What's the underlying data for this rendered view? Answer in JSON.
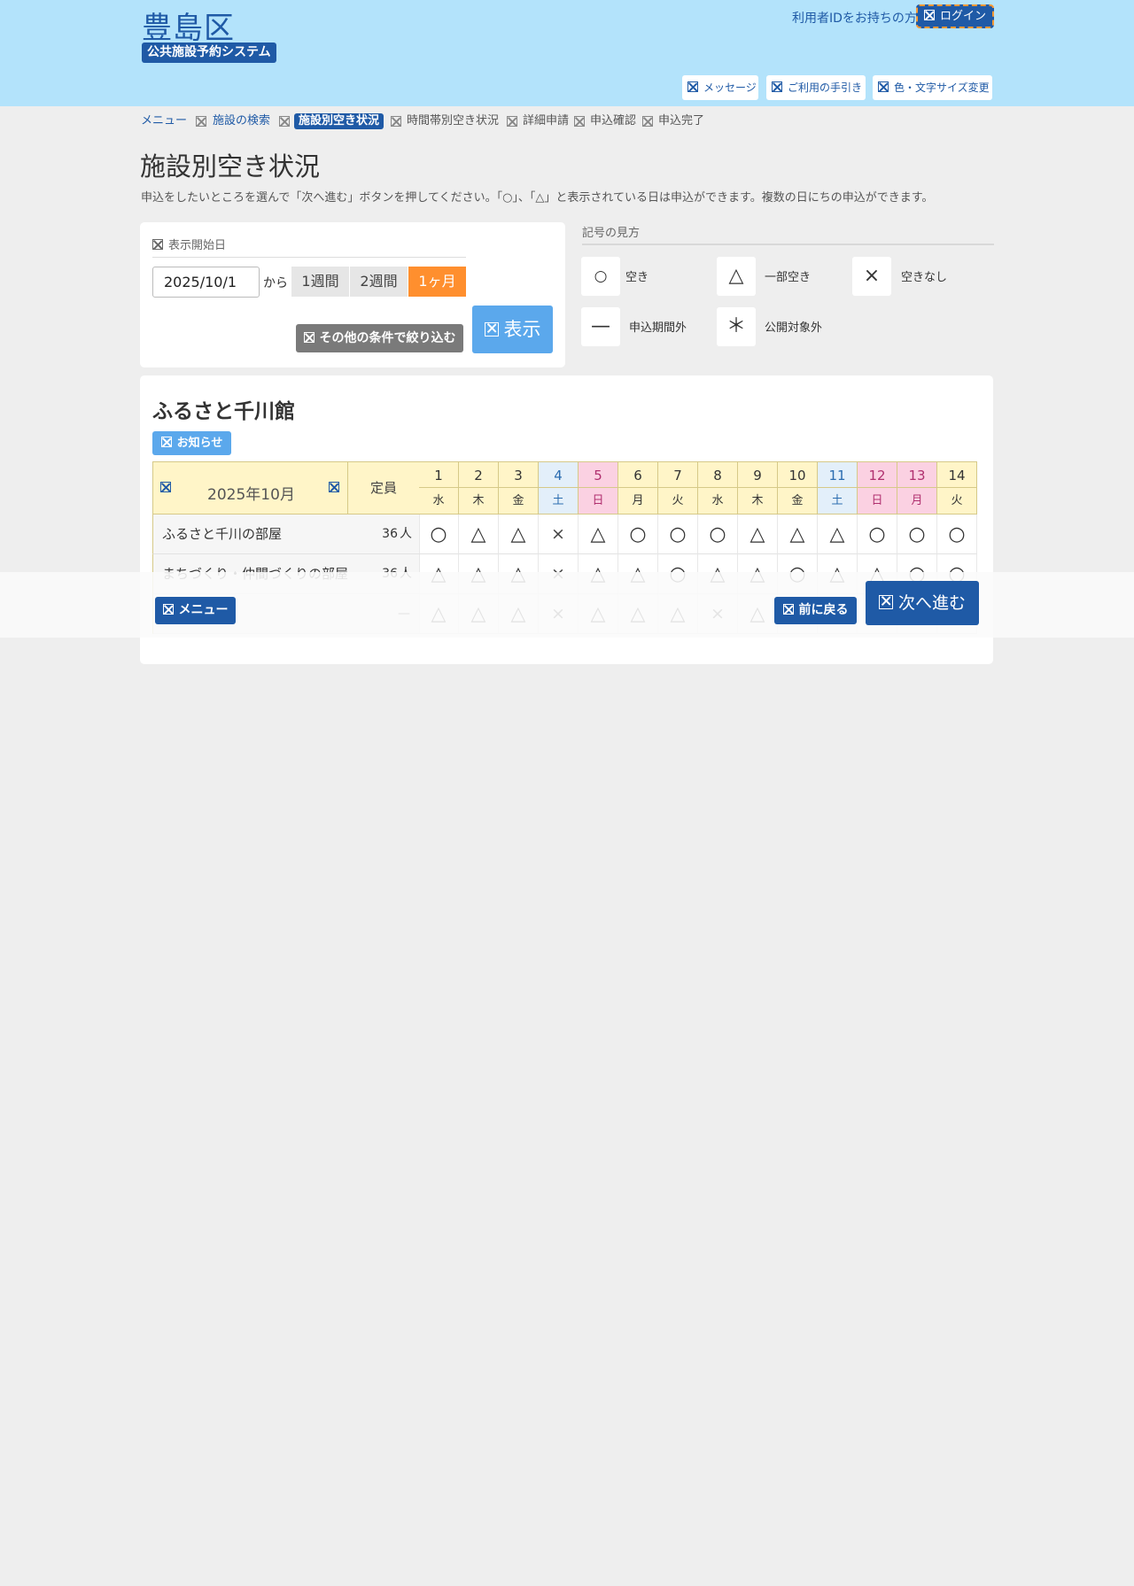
{
  "header": {
    "title": "豊島区",
    "subtitle": "公共施設予約システム",
    "login_prompt": "利用者IDをお持ちの方",
    "login_label": "ログイン",
    "buttons": [
      "メッセージ",
      "ご利用の手引き",
      "色・文字サイズ変更"
    ]
  },
  "breadcrumb": [
    "メニュー",
    "施設の検索",
    "施設別空き状況",
    "時間帯別空き状況",
    "詳細申請",
    "申込確認",
    "申込完了"
  ],
  "page": {
    "title": "施設別空き状況",
    "description": "申込をしたいところを選んで「次へ進む」ボタンを押してください。「○」、「△」と表示されている日は申込ができます。複数の日にちの申込ができます。"
  },
  "search": {
    "start_date_label": "表示開始日",
    "start_date_value": "2025/10/1",
    "from_label": "から",
    "periods": [
      "1週間",
      "2週間",
      "1ヶ月"
    ],
    "selected_period": "1ヶ月",
    "filter_label": "その他の条件で絞り込む",
    "show_label": "表示"
  },
  "legend": {
    "title": "記号の見方",
    "items": [
      {
        "symbol": "○",
        "label": "空き"
      },
      {
        "symbol": "△",
        "label": "一部空き"
      },
      {
        "symbol": "×",
        "label": "空きなし"
      },
      {
        "symbol": "—",
        "label": "申込期間外"
      },
      {
        "symbol": "＊",
        "label": "公開対象外"
      }
    ]
  },
  "facility": {
    "name": "ふるさと千川館",
    "notice_label": "お知らせ",
    "month_label": "2025年10月",
    "capacity_header": "定員",
    "days": [
      {
        "d": "1",
        "wd": "水",
        "type": "wk"
      },
      {
        "d": "2",
        "wd": "木",
        "type": "wk"
      },
      {
        "d": "3",
        "wd": "金",
        "type": "wk"
      },
      {
        "d": "4",
        "wd": "土",
        "type": "sat"
      },
      {
        "d": "5",
        "wd": "日",
        "type": "sun"
      },
      {
        "d": "6",
        "wd": "月",
        "type": "wk"
      },
      {
        "d": "7",
        "wd": "火",
        "type": "wk"
      },
      {
        "d": "8",
        "wd": "水",
        "type": "wk"
      },
      {
        "d": "9",
        "wd": "木",
        "type": "wk"
      },
      {
        "d": "10",
        "wd": "金",
        "type": "wk"
      },
      {
        "d": "11",
        "wd": "土",
        "type": "sat"
      },
      {
        "d": "12",
        "wd": "日",
        "type": "sun"
      },
      {
        "d": "13",
        "wd": "月",
        "type": "sun"
      },
      {
        "d": "14",
        "wd": "火",
        "type": "wk"
      }
    ],
    "rooms": [
      {
        "name": "ふるさと千川の部屋",
        "capacity": "36",
        "unit": "人",
        "marks": [
          "○",
          "△",
          "△",
          "×",
          "△",
          "○",
          "○",
          "○",
          "△",
          "△",
          "△",
          "○",
          "○",
          "○"
        ]
      },
      {
        "name": "まちづくり・仲間づくりの部屋",
        "capacity": "36",
        "unit": "人",
        "marks": [
          "△",
          "△",
          "△",
          "×",
          "△",
          "△",
          "○",
          "△",
          "△",
          "○",
          "△",
          "△",
          "○",
          "○"
        ]
      },
      {
        "name": "",
        "capacity": "—",
        "unit": "",
        "marks": [
          "△",
          "△",
          "△",
          "×",
          "△",
          "△",
          "△",
          "×",
          "△",
          "",
          "",
          "",
          "",
          ""
        ]
      }
    ]
  },
  "footer": {
    "menu_label": "メニュー",
    "back_label": "前に戻る",
    "next_label": "次へ進む"
  }
}
